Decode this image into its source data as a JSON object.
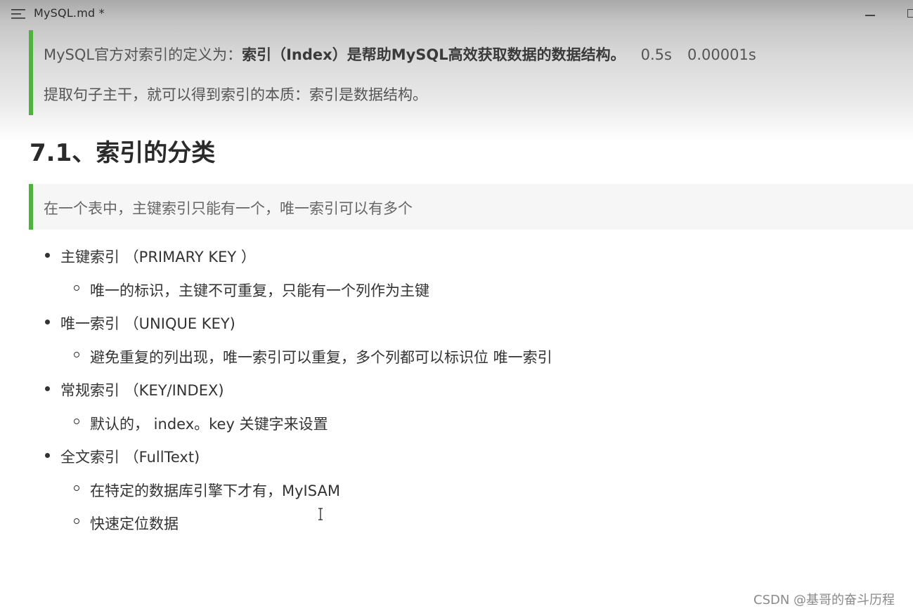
{
  "window": {
    "title": "MySQL.md *"
  },
  "quote1": {
    "prefix": "MySQL官方对索引的定义为：",
    "bold": "索引（Index）是帮助MySQL高效获取数据的数据结构。",
    "time1": "0.5s",
    "time2": "0.00001s",
    "line2": "提取句子主干，就可以得到索引的本质：索引是数据结构。"
  },
  "section": {
    "heading": "7.1、索引的分类"
  },
  "quote2": {
    "text": "在一个表中，主键索引只能有一个，唯一索引可以有多个"
  },
  "list": {
    "items": [
      {
        "label": "主键索引 （PRIMARY KEY ）",
        "sub": [
          "唯一的标识，主键不可重复，只能有一个列作为主键"
        ]
      },
      {
        "label": "唯一索引 （UNIQUE KEY)",
        "sub": [
          "避免重复的列出现，唯一索引可以重复，多个列都可以标识位 唯一索引"
        ]
      },
      {
        "label": "常规索引 （KEY/INDEX)",
        "sub": [
          "默认的， index。key 关键字来设置"
        ]
      },
      {
        "label": "全文索引 （FullText)",
        "sub": [
          "在特定的数据库引擎下才有，MyISAM",
          "快速定位数据"
        ]
      }
    ]
  },
  "watermark": "CSDN @基哥的奋斗历程",
  "colors": {
    "accent_bar": "#4db33d",
    "quote_bg": "#f6f6f6",
    "text": "#333333"
  },
  "icons": {
    "menu": "hamburger-menu-icon",
    "minimize": "minimize-icon",
    "maximize": "maximize-icon",
    "cursor": "text-cursor-icon"
  }
}
